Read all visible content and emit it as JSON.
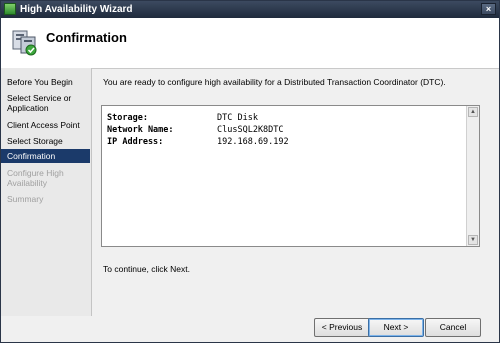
{
  "window": {
    "title": "High Availability Wizard",
    "close_label": "×"
  },
  "header": {
    "title": "Confirmation",
    "icon": "cluster-wizard-icon"
  },
  "sidebar": {
    "items": [
      {
        "label": "Before You Begin",
        "state": "normal"
      },
      {
        "label": "Select Service or Application",
        "state": "normal"
      },
      {
        "label": "Client Access Point",
        "state": "normal"
      },
      {
        "label": "Select Storage",
        "state": "normal"
      },
      {
        "label": "Confirmation",
        "state": "active"
      },
      {
        "label": "Configure High Availability",
        "state": "disabled"
      },
      {
        "label": "Summary",
        "state": "disabled"
      }
    ]
  },
  "main": {
    "intro": "You are ready to configure high availability for a Distributed Transaction Coordinator (DTC).",
    "summary": [
      {
        "key": "Storage:",
        "value": "DTC Disk"
      },
      {
        "key": "Network Name:",
        "value": "ClusSQL2K8DTC"
      },
      {
        "key": "IP Address:",
        "value": "192.168.69.192"
      }
    ],
    "continue_text": "To continue, click Next."
  },
  "buttons": {
    "previous": "< Previous",
    "next": "Next >",
    "cancel": "Cancel"
  },
  "colors": {
    "titlebar": "#1f2a3c",
    "active_nav": "#1b3a6a",
    "disabled_text": "#a0a0a0"
  }
}
